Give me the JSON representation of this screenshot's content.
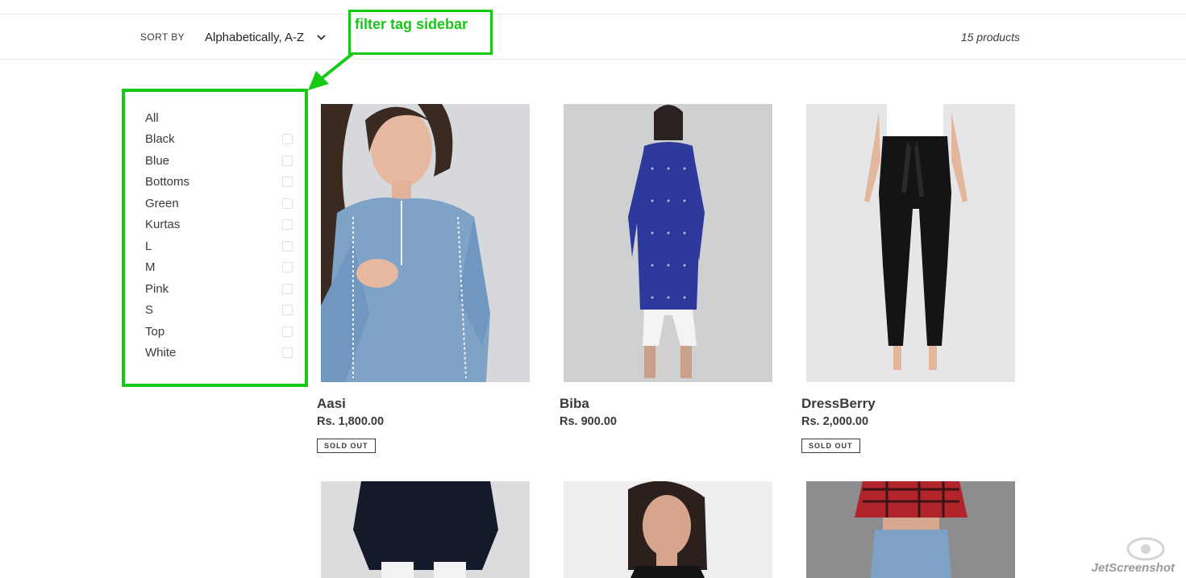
{
  "toolbar": {
    "sort_label": "SORT BY",
    "sort_value": "Alphabetically, A-Z",
    "product_count": "15 products"
  },
  "annotation": {
    "label": "filter tag sidebar",
    "color": "#17c917"
  },
  "sidebar": {
    "tags": [
      {
        "label": "All"
      },
      {
        "label": "Black"
      },
      {
        "label": "Blue"
      },
      {
        "label": "Bottoms"
      },
      {
        "label": "Green"
      },
      {
        "label": "Kurtas"
      },
      {
        "label": "L"
      },
      {
        "label": "M"
      },
      {
        "label": "Pink"
      },
      {
        "label": "S"
      },
      {
        "label": "Top"
      },
      {
        "label": "White"
      }
    ]
  },
  "products": [
    {
      "title": "Aasi",
      "price": "Rs. 1,800.00",
      "badge": "SOLD OUT"
    },
    {
      "title": "Biba",
      "price": "Rs. 900.00",
      "badge": ""
    },
    {
      "title": "DressBerry",
      "price": "Rs. 2,000.00",
      "badge": "SOLD OUT"
    }
  ],
  "watermark": {
    "text": "JetScreenshot"
  }
}
